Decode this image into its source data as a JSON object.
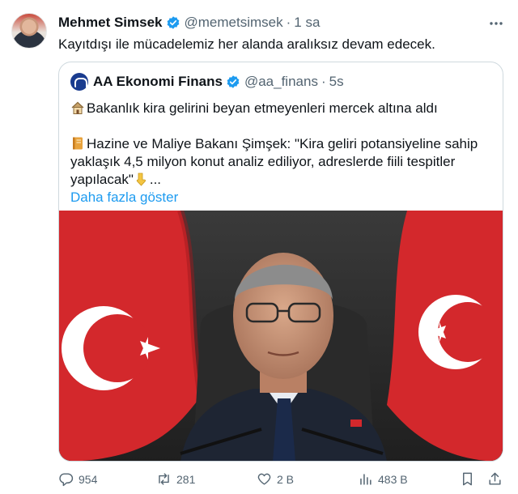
{
  "tweet": {
    "author_name": "Mehmet Simsek",
    "author_handle": "@memetsimsek",
    "separator": "·",
    "time": "1 sa",
    "text": "Kayıtdışı ile mücadelemiz her alanda aralıksız devam edecek."
  },
  "quote": {
    "author_name": "AA Ekonomi Finans",
    "author_handle": "@aa_finans",
    "separator": "·",
    "time": "5s",
    "line1": "Bakanlık kira gelirini beyan etmeyenleri mercek altına aldı",
    "line2": "Hazine ve Maliye Bakanı Şimşek: \"Kira geliri potansiyeline sahip yaklaşık 4,5 milyon konut analiz ediliyor, adreslerde fiili tespitler yapılacak\"",
    "ellipsis": "...",
    "show_more": "Daha fazla göster"
  },
  "actions": {
    "replies": "954",
    "retweets": "281",
    "likes": "2 B",
    "views": "483 B"
  },
  "colors": {
    "accent": "#1d9bf0",
    "muted": "#536471",
    "text": "#0f1419",
    "border": "#cfd9de"
  },
  "icons": [
    "verified-badge-icon",
    "more-icon",
    "house-emoji-icon",
    "notebook-emoji-icon",
    "pointing-down-emoji-icon",
    "reply-icon",
    "retweet-icon",
    "like-icon",
    "views-icon",
    "bookmark-icon",
    "share-icon"
  ]
}
